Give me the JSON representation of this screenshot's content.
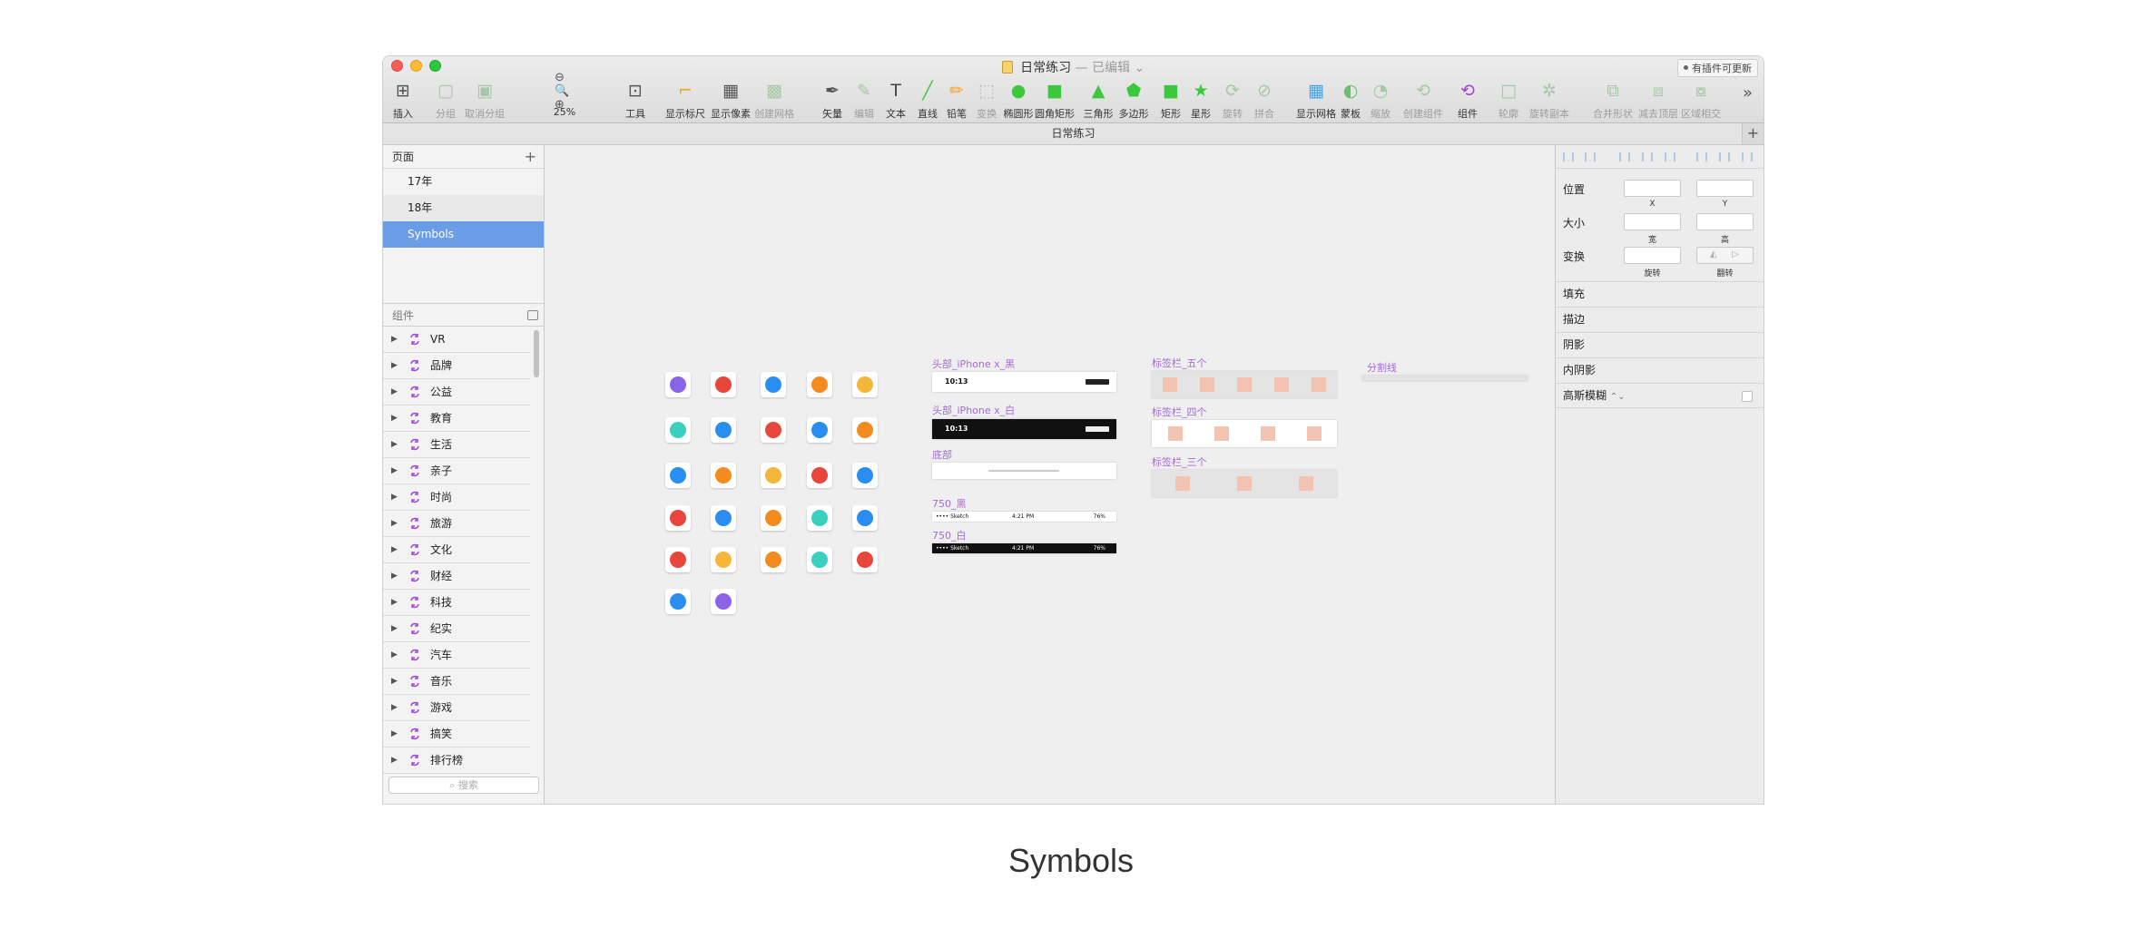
{
  "window": {
    "title": "日常练习",
    "edited": "— 已编辑",
    "plugin_badge": "有插件可更新"
  },
  "toolbar": [
    {
      "id": "insert",
      "label": "插入",
      "icon": "plus-icon"
    },
    {
      "id": "group",
      "label": "分组",
      "icon": "group-icon",
      "dim": true
    },
    {
      "id": "ungroup",
      "label": "取消分组",
      "icon": "ungroup-icon",
      "dim": true
    },
    {
      "id": "zoom",
      "label": "25%",
      "icon": "zoom-icon"
    },
    {
      "id": "tools",
      "label": "工具",
      "icon": "tools-icon"
    },
    {
      "id": "rulers",
      "label": "显示标尺",
      "icon": "ruler-icon"
    },
    {
      "id": "pixels",
      "label": "显示像素",
      "icon": "pixel-icon"
    },
    {
      "id": "grid",
      "label": "创建网格",
      "icon": "grid-icon",
      "dim": true
    },
    {
      "id": "vector",
      "label": "矢量",
      "icon": "pen-icon"
    },
    {
      "id": "edit",
      "label": "编辑",
      "icon": "edit-icon",
      "dim": true
    },
    {
      "id": "text",
      "label": "文本",
      "icon": "text-icon"
    },
    {
      "id": "line",
      "label": "直线",
      "icon": "line-icon"
    },
    {
      "id": "pencil",
      "label": "铅笔",
      "icon": "pencil-icon"
    },
    {
      "id": "transform",
      "label": "变换",
      "icon": "transform-icon",
      "dim": true
    },
    {
      "id": "oval",
      "label": "椭圆形",
      "icon": "oval-icon"
    },
    {
      "id": "rounded",
      "label": "圆角矩形",
      "icon": "rounded-rect-icon"
    },
    {
      "id": "triangle",
      "label": "三角形",
      "icon": "triangle-icon"
    },
    {
      "id": "polygon",
      "label": "多边形",
      "icon": "polygon-icon"
    },
    {
      "id": "rect",
      "label": "矩形",
      "icon": "rectangle-icon"
    },
    {
      "id": "star",
      "label": "星形",
      "icon": "star-icon"
    },
    {
      "id": "rotate",
      "label": "旋转",
      "icon": "rotate-icon",
      "dim": true
    },
    {
      "id": "join",
      "label": "拼合",
      "icon": "join-icon",
      "dim": true
    },
    {
      "id": "showgrid",
      "label": "显示网格",
      "icon": "show-grid-icon"
    },
    {
      "id": "mask",
      "label": "蒙板",
      "icon": "mask-icon"
    },
    {
      "id": "scale",
      "label": "缩放",
      "icon": "scale-icon",
      "dim": true
    },
    {
      "id": "createsymbol",
      "label": "创建组件",
      "icon": "create-symbol-icon",
      "dim": true
    },
    {
      "id": "symbol",
      "label": "组件",
      "icon": "symbol-icon"
    },
    {
      "id": "outline",
      "label": "轮廓",
      "icon": "outline-icon",
      "dim": true
    },
    {
      "id": "rotatecopies",
      "label": "旋转副本",
      "icon": "rotate-copies-icon",
      "dim": true
    },
    {
      "id": "union",
      "label": "合并形状",
      "icon": "union-icon",
      "dim": true
    },
    {
      "id": "subtract",
      "label": "减去顶层",
      "icon": "subtract-icon",
      "dim": true
    },
    {
      "id": "intersect",
      "label": "区域相交",
      "icon": "intersect-icon",
      "dim": true
    }
  ],
  "tabbar": {
    "title": "日常练习",
    "add": "+"
  },
  "sidebar": {
    "pages_header": "页面",
    "pages": [
      {
        "label": "17年",
        "state": "normal"
      },
      {
        "label": "18年",
        "state": "alt"
      },
      {
        "label": "Symbols",
        "state": "sel"
      }
    ],
    "components_header": "组件",
    "components": [
      "VR",
      "品牌",
      "公益",
      "教育",
      "生活",
      "亲子",
      "时尚",
      "旅游",
      "文化",
      "财经",
      "科技",
      "纪实",
      "汽车",
      "音乐",
      "游戏",
      "搞笑",
      "排行榜"
    ],
    "search_placeholder": "搜索"
  },
  "canvas": {
    "artboards": [
      {
        "id": "header-black",
        "label": "头部_iPhone x_黑",
        "time": "10:13"
      },
      {
        "id": "header-white",
        "label": "头部_iPhone x_白",
        "time": "10:13"
      },
      {
        "id": "footer",
        "label": "底部"
      },
      {
        "id": "750-black",
        "label": "750_黑",
        "carrier": "•••• Sketch",
        "time": "4:21 PM",
        "battery": "76%"
      },
      {
        "id": "750-white",
        "label": "750_白",
        "carrier": "•••• Sketch",
        "time": "4:21 PM",
        "battery": "76%"
      },
      {
        "id": "tabbar5",
        "label": "标签栏_五个"
      },
      {
        "id": "tabbar4",
        "label": "标签栏_四个"
      },
      {
        "id": "tabbar3",
        "label": "标签栏_三个"
      },
      {
        "id": "divider",
        "label": "分割线"
      }
    ],
    "icon_colors": [
      [
        "#8b63e8",
        "#e8453c",
        "#2a8ef0",
        "#f38b1f",
        "#f4b739"
      ],
      [
        "#3bcfbf",
        "#2a8ef0",
        "#e8453c",
        "#2a8ef0",
        "#f38b1f"
      ],
      [
        "#2a8ef0",
        "#f38b1f",
        "#f4b739",
        "#e8453c",
        "#2a8ef0"
      ],
      [
        "#e8453c",
        "#2a8ef0",
        "#f38b1f",
        "#3bcfbf",
        "#2a8ef0"
      ],
      [
        "#e8453c",
        "#f4b739",
        "#f38b1f",
        "#3bcfbf",
        "#e8453c"
      ],
      [
        "#2a8ef0",
        "#8b63e8"
      ]
    ]
  },
  "inspector": {
    "position_label": "位置",
    "x_label": "X",
    "y_label": "Y",
    "size_label": "大小",
    "w_label": "宽",
    "h_label": "高",
    "transform_label": "变换",
    "rotate_label": "旋转",
    "flip_label": "翻转",
    "sections": [
      "填充",
      "描边",
      "阴影",
      "内阴影",
      "高斯模糊"
    ]
  },
  "caption": "Symbols"
}
